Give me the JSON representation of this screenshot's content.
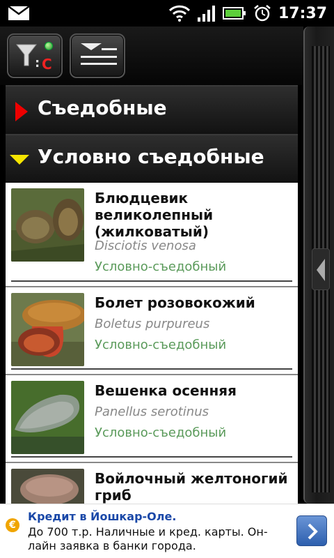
{
  "status_bar": {
    "time": "17:37",
    "icons": [
      "mail-icon",
      "wifi-icon",
      "signal-icon",
      "battery-icon",
      "alarm-icon"
    ]
  },
  "toolbar": {
    "filter_button_badge": "C",
    "buttons": [
      "filter-button",
      "list-view-button"
    ]
  },
  "categories": [
    {
      "label": "Съедобные",
      "state": "collapsed"
    },
    {
      "label": "Условно съедобные",
      "state": "expanded"
    }
  ],
  "items": [
    {
      "name": "Блюдцевик великолепный (жилковатый)",
      "latin": "Disciotis venosa",
      "kind": "Условно-съедобный"
    },
    {
      "name": "Болет розовокожий",
      "latin": "Boletus purpureus",
      "kind": "Условно-съедобный"
    },
    {
      "name": "Вешенка осенняя",
      "latin": "Panellus serotinus",
      "kind": "Условно-съедобный"
    },
    {
      "name": "Войлочный желтоногий гриб",
      "latin": "",
      "kind": ""
    }
  ],
  "ad": {
    "logo": "€",
    "headline": "Кредит в Йошкар-Оле.",
    "body": "До 700 т.р. Наличные и кред. карты. Он-лайн заявка в банки города."
  },
  "colors": {
    "expand_arrow": "#f5e500",
    "collapse_arrow": "#ee0000",
    "kind_text": "#5a9a5a",
    "ad_headline": "#1a48a8"
  }
}
